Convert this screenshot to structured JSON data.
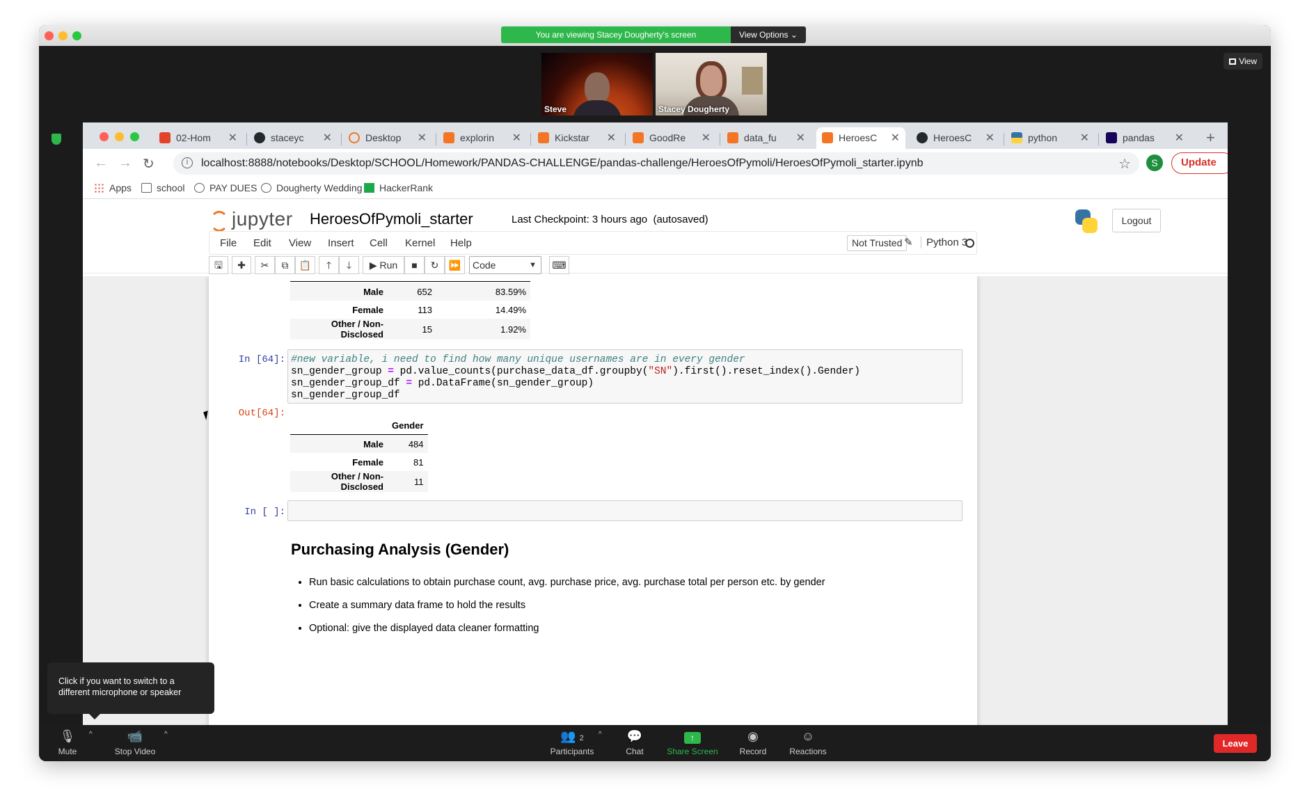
{
  "zoom": {
    "viewing_banner": "You are viewing Stacey Dougherty's screen",
    "view_options": "View Options",
    "view_button": "View",
    "participants": [
      {
        "name": "Steve"
      },
      {
        "name": "Stacey Dougherty"
      }
    ],
    "controls": {
      "mute": "Mute",
      "stop_video": "Stop Video",
      "participants": "Participants",
      "participants_count": "2",
      "chat": "Chat",
      "share_screen": "Share Screen",
      "record": "Record",
      "reactions": "Reactions",
      "leave": "Leave"
    },
    "mic_tooltip": "Click if you want to switch to a different microphone or speaker",
    "colors": {
      "green": "#2eb84b",
      "leave_red": "#e02828"
    }
  },
  "browser": {
    "tabs": [
      {
        "title": "02-Hom",
        "icon": "gitlab-icon"
      },
      {
        "title": "staceyc",
        "icon": "github-icon"
      },
      {
        "title": "Desktop",
        "icon": "jupyter-icon"
      },
      {
        "title": "explorin",
        "icon": "notebook-icon"
      },
      {
        "title": "Kickstar",
        "icon": "notebook-icon"
      },
      {
        "title": "GoodRe",
        "icon": "notebook-icon"
      },
      {
        "title": "data_fu",
        "icon": "notebook-icon"
      },
      {
        "title": "HeroesC",
        "icon": "notebook-icon",
        "active": true
      },
      {
        "title": "HeroesC",
        "icon": "github-icon"
      },
      {
        "title": "python",
        "icon": "python-icon"
      },
      {
        "title": "pandas",
        "icon": "pandas-icon"
      }
    ],
    "url": "localhost:8888/notebooks/Desktop/SCHOOL/Homework/PANDAS-CHALLENGE/pandas-challenge/HeroesOfPymoli/HeroesOfPymoli_starter.ipynb",
    "profile_initial": "S",
    "update_label": "Update",
    "bookmarks": [
      "Apps",
      "school",
      "PAY DUES",
      "Dougherty Wedding",
      "HackerRank"
    ]
  },
  "jupyter": {
    "logo_text": "jupyter",
    "notebook_title": "HeroesOfPymoli_starter",
    "checkpoint": "Last Checkpoint: 3 hours ago",
    "autosaved": "(autosaved)",
    "logout": "Logout",
    "menu": [
      "File",
      "Edit",
      "View",
      "Insert",
      "Cell",
      "Kernel",
      "Help"
    ],
    "not_trusted": "Not Trusted",
    "kernel": "Python 3",
    "run_label": "Run",
    "cell_type": "Code"
  },
  "notebook": {
    "table1": {
      "rows": [
        {
          "label": "Male",
          "count": "652",
          "pct": "83.59%"
        },
        {
          "label": "Female",
          "count": "113",
          "pct": "14.49%"
        },
        {
          "label": "Other / Non-Disclosed",
          "count": "15",
          "pct": "1.92%"
        }
      ]
    },
    "cell64": {
      "prompt_in": "In [64]:",
      "prompt_out": "Out[64]:",
      "line1": "#new variable, i need to find how many unique usernames are in every gender",
      "line2_a": "sn_gender_group ",
      "line2_op": "=",
      "line2_b": " pd.value_counts(purchase_data_df.groupby(",
      "line2_str": "\"SN\"",
      "line2_c": ").first().reset_index().Gender)",
      "line3_a": "sn_gender_group_df ",
      "line3_op": "=",
      "line3_b": " pd.DataFrame(sn_gender_group)",
      "line4": "sn_gender_group_df"
    },
    "table2": {
      "header": "Gender",
      "rows": [
        {
          "label": "Male",
          "value": "484"
        },
        {
          "label": "Female",
          "value": "81"
        },
        {
          "label": "Other / Non-Disclosed",
          "value": "11"
        }
      ]
    },
    "empty_prompt": "In [ ]:",
    "md_heading": "Purchasing Analysis (Gender)",
    "md_bullets": [
      "Run basic calculations to obtain purchase count, avg. purchase price, avg. purchase total per person etc. by gender",
      "Create a summary data frame to hold the results",
      "Optional: give the displayed data cleaner formatting"
    ]
  }
}
